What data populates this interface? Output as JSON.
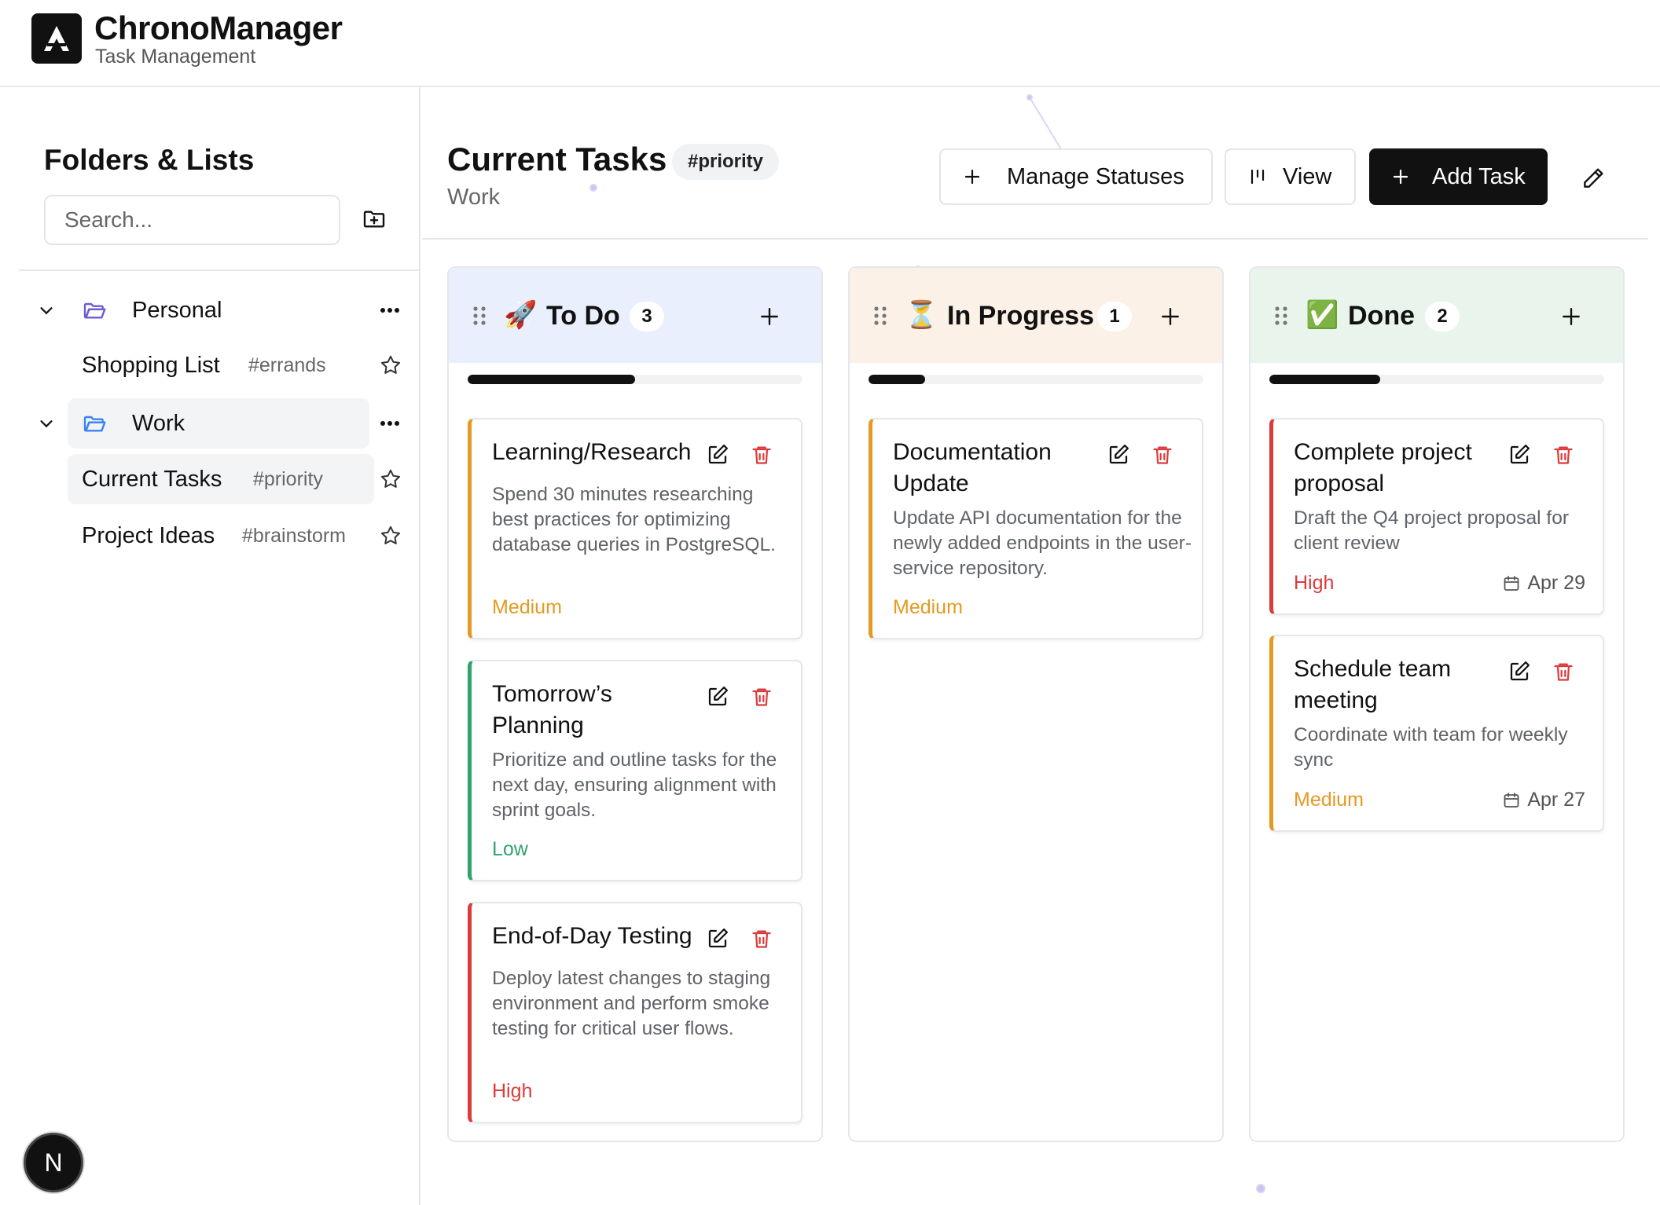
{
  "app": {
    "title": "ChronoManager",
    "subtitle": "Task Management"
  },
  "sidebar": {
    "title": "Folders & Lists",
    "search_placeholder": "Search...",
    "folders": [
      {
        "label": "Personal",
        "lists": [
          {
            "label": "Shopping List",
            "tag": "#errands"
          }
        ]
      },
      {
        "label": "Work",
        "lists": [
          {
            "label": "Current Tasks",
            "tag": "#priority"
          },
          {
            "label": "Project Ideas",
            "tag": "#brainstorm"
          }
        ]
      }
    ]
  },
  "avatar": {
    "initial": "N"
  },
  "page": {
    "title": "Current Tasks",
    "tag": "#priority",
    "subtitle": "Work",
    "manage_statuses_label": "Manage Statuses",
    "view_label": "View",
    "add_task_label": "Add Task"
  },
  "columns": [
    {
      "emoji": "🚀",
      "title": "To Do",
      "count": "3",
      "progress": 0.5,
      "header_color": "#e9effc",
      "cards": [
        {
          "title": "Learning/Research",
          "description": "Spend 30 minutes researching best practices for optimizing database queries in PostgreSQL.",
          "priority": "Medium"
        },
        {
          "title": "Tomorrow’s Planning",
          "description": "Prioritize and outline tasks for the next day, ensuring alignment with sprint goals.",
          "priority": "Low"
        },
        {
          "title": "End-of-Day Testing",
          "description": "Deploy latest changes to staging environment and perform smoke testing for critical user flows.",
          "priority": "High"
        }
      ]
    },
    {
      "emoji": "⏳",
      "title": "In Progress",
      "count": "1",
      "progress": 0.17,
      "header_color": "#fbf1e6",
      "cards": [
        {
          "title": "Documentation Update",
          "description": "Update API documentation for the newly added endpoints in the user-service repository.",
          "priority": "Medium"
        }
      ]
    },
    {
      "emoji": "✅",
      "title": "Done",
      "count": "2",
      "progress": 0.33,
      "header_color": "#e8f4ec",
      "cards": [
        {
          "title": "Complete project proposal",
          "description": "Draft the Q4 project proposal for client review",
          "priority": "High",
          "date": "Apr 29"
        },
        {
          "title": "Schedule team meeting",
          "description": "Coordinate with team for weekly sync",
          "priority": "Medium",
          "date": "Apr 27"
        }
      ]
    }
  ],
  "colors": {
    "medium": "#e59a22",
    "low": "#2fa36b",
    "high": "#dc3b3b",
    "accent_folder": "#6d5bd0"
  }
}
